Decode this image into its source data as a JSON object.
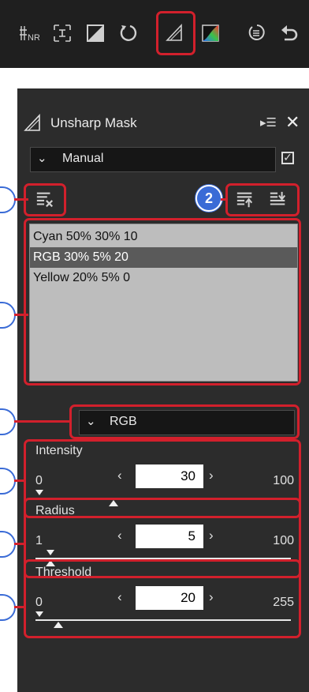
{
  "toolbar": {
    "icons": [
      "noise-reduction-icon",
      "fit-icon",
      "exposure-icon",
      "rotate-icon",
      "unsharp-mask-icon",
      "color-curve-icon",
      "list-icon",
      "undo-icon"
    ],
    "nr_label": "NR"
  },
  "panel": {
    "title": "Unsharp Mask",
    "menu_glyph": "▸☰",
    "close_glyph": "✕",
    "preset": "Manual",
    "enabled": true
  },
  "callouts": {
    "two": "2"
  },
  "masks": [
    {
      "label": "Cyan 50% 30% 10",
      "selected": false
    },
    {
      "label": "RGB 30% 5% 20",
      "selected": true
    },
    {
      "label": "Yellow 20% 5% 0",
      "selected": false
    }
  ],
  "channel": "RGB",
  "intensity": {
    "title": "Intensity",
    "value": "30",
    "min": "0",
    "max": "100"
  },
  "radius": {
    "title": "Radius",
    "value": "5",
    "min": "1",
    "max": "100"
  },
  "threshold": {
    "title": "Threshold",
    "value": "20",
    "min": "0",
    "max": "255"
  },
  "arrows": {
    "left": "‹",
    "right": "›"
  },
  "colors": {
    "highlight": "#d2202c",
    "callout": "#3a6bd6",
    "panel_bg": "#2c2c2c"
  }
}
